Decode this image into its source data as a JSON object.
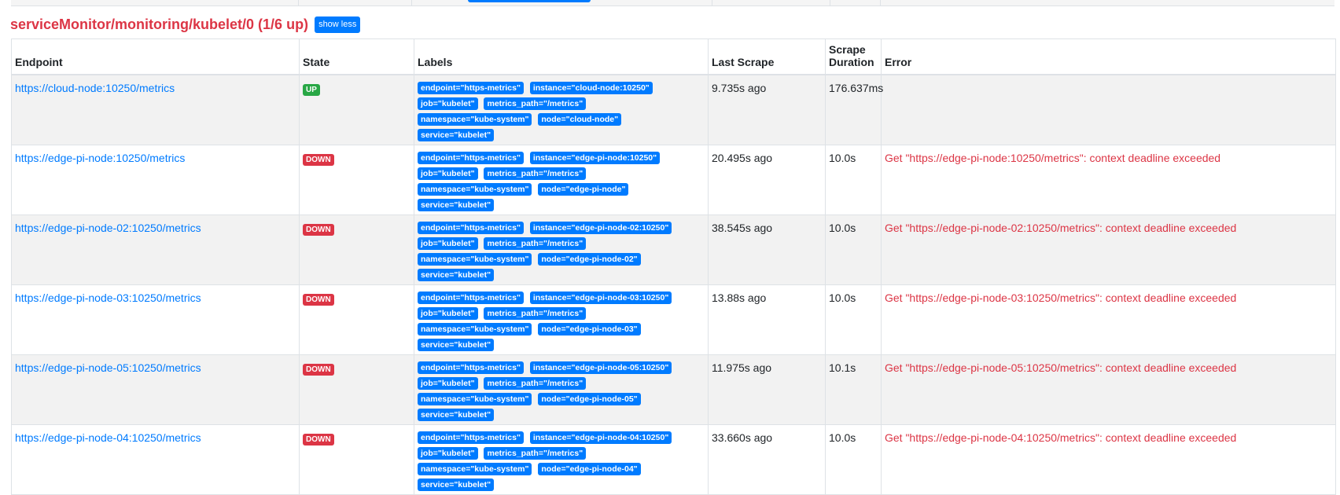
{
  "section": {
    "title": "serviceMonitor/monitoring/kubelet/0 (1/6 up)",
    "toggle_label": "show less"
  },
  "table": {
    "headers": {
      "endpoint": "Endpoint",
      "state": "State",
      "labels": "Labels",
      "last_scrape": "Last Scrape",
      "scrape_duration_1": "Scrape",
      "scrape_duration_2": "Duration",
      "error": "Error"
    },
    "rows": [
      {
        "endpoint": "https://cloud-node:10250/metrics",
        "state": "UP",
        "labels": [
          "endpoint=\"https-metrics\"",
          "instance=\"cloud-node:10250\"",
          "job=\"kubelet\"",
          "metrics_path=\"/metrics\"",
          "namespace=\"kube-system\"",
          "node=\"cloud-node\"",
          "service=\"kubelet\""
        ],
        "last_scrape": "9.735s ago",
        "duration": "176.637ms",
        "error": ""
      },
      {
        "endpoint": "https://edge-pi-node:10250/metrics",
        "state": "DOWN",
        "labels": [
          "endpoint=\"https-metrics\"",
          "instance=\"edge-pi-node:10250\"",
          "job=\"kubelet\"",
          "metrics_path=\"/metrics\"",
          "namespace=\"kube-system\"",
          "node=\"edge-pi-node\"",
          "service=\"kubelet\""
        ],
        "last_scrape": "20.495s ago",
        "duration": "10.0s",
        "error": "Get \"https://edge-pi-node:10250/metrics\": context deadline exceeded"
      },
      {
        "endpoint": "https://edge-pi-node-02:10250/metrics",
        "state": "DOWN",
        "labels": [
          "endpoint=\"https-metrics\"",
          "instance=\"edge-pi-node-02:10250\"",
          "job=\"kubelet\"",
          "metrics_path=\"/metrics\"",
          "namespace=\"kube-system\"",
          "node=\"edge-pi-node-02\"",
          "service=\"kubelet\""
        ],
        "last_scrape": "38.545s ago",
        "duration": "10.0s",
        "error": "Get \"https://edge-pi-node-02:10250/metrics\": context deadline exceeded"
      },
      {
        "endpoint": "https://edge-pi-node-03:10250/metrics",
        "state": "DOWN",
        "labels": [
          "endpoint=\"https-metrics\"",
          "instance=\"edge-pi-node-03:10250\"",
          "job=\"kubelet\"",
          "metrics_path=\"/metrics\"",
          "namespace=\"kube-system\"",
          "node=\"edge-pi-node-03\"",
          "service=\"kubelet\""
        ],
        "last_scrape": "13.88s ago",
        "duration": "10.0s",
        "error": "Get \"https://edge-pi-node-03:10250/metrics\": context deadline exceeded"
      },
      {
        "endpoint": "https://edge-pi-node-05:10250/metrics",
        "state": "DOWN",
        "labels": [
          "endpoint=\"https-metrics\"",
          "instance=\"edge-pi-node-05:10250\"",
          "job=\"kubelet\"",
          "metrics_path=\"/metrics\"",
          "namespace=\"kube-system\"",
          "node=\"edge-pi-node-05\"",
          "service=\"kubelet\""
        ],
        "last_scrape": "11.975s ago",
        "duration": "10.1s",
        "error": "Get \"https://edge-pi-node-05:10250/metrics\": context deadline exceeded"
      },
      {
        "endpoint": "https://edge-pi-node-04:10250/metrics",
        "state": "DOWN",
        "labels": [
          "endpoint=\"https-metrics\"",
          "instance=\"edge-pi-node-04:10250\"",
          "job=\"kubelet\"",
          "metrics_path=\"/metrics\"",
          "namespace=\"kube-system\"",
          "node=\"edge-pi-node-04\"",
          "service=\"kubelet\""
        ],
        "last_scrape": "33.660s ago",
        "duration": "10.0s",
        "error": "Get \"https://edge-pi-node-04:10250/metrics\": context deadline exceeded"
      }
    ]
  },
  "colors": {
    "title": "#dc3545",
    "link": "#007bff",
    "badge_up": "#28a745",
    "badge_down": "#dc3545",
    "label_badge": "#007bff",
    "error_text": "#dc3545"
  }
}
